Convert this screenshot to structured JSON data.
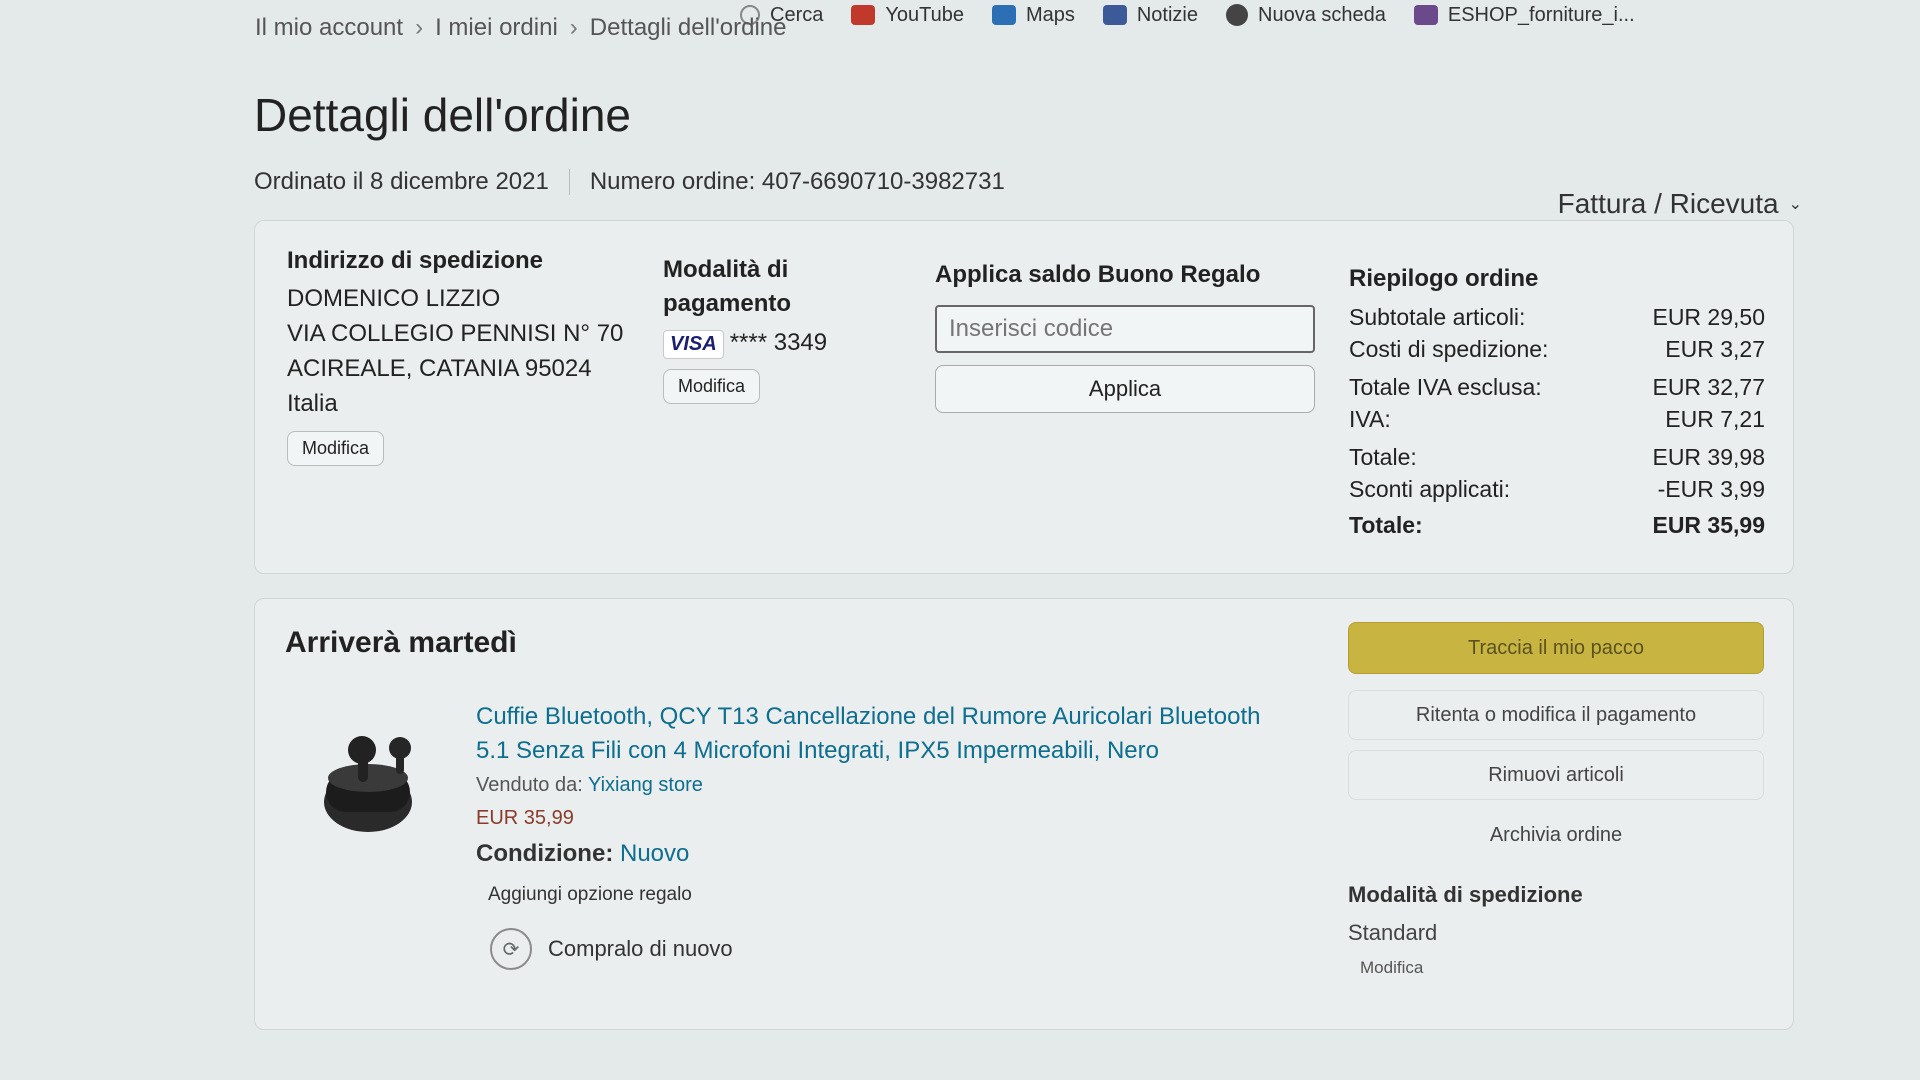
{
  "bookmarks": [
    {
      "label": "Cerca",
      "icon": "search-icon",
      "color": "#888888"
    },
    {
      "label": "YouTube",
      "icon": "youtube-icon",
      "color": "#c0392b"
    },
    {
      "label": "Maps",
      "icon": "maps-icon",
      "color": "#2c6fb5"
    },
    {
      "label": "Notizie",
      "icon": "news-icon",
      "color": "#3d5a98"
    },
    {
      "label": "Nuova scheda",
      "icon": "new-tab-icon",
      "color": "#444444"
    },
    {
      "label": "ESHOP_forniture_i...",
      "icon": "bag-icon",
      "color": "#6a4a8a"
    }
  ],
  "breadcrumb": {
    "items": [
      "Il mio account",
      "I miei ordini",
      "Dettagli dell'ordine"
    ],
    "separator": "›"
  },
  "page_title": "Dettagli dell'ordine",
  "order": {
    "date": "Ordinato il 8 dicembre 2021",
    "number": "Numero ordine: 407-6690710-3982731"
  },
  "invoice_label": "Fattura / Ricevuta",
  "shipping_address": {
    "title": "Indirizzo di spedizione",
    "name": "DOMENICO LIZZIO",
    "street": "VIA COLLEGIO PENNISI N° 70",
    "city": "ACIREALE, CATANIA 95024",
    "country": "Italia",
    "edit": "Modifica"
  },
  "payment": {
    "title": "Modalità di pagamento",
    "card_brand": "VISA",
    "card_digits": "**** 3349",
    "edit": "Modifica"
  },
  "gift_card": {
    "title": "Applica saldo Buono Regalo",
    "placeholder": "Inserisci codice",
    "apply": "Applica"
  },
  "summary": {
    "title": "Riepilogo ordine",
    "rows": [
      {
        "label": "Subtotale articoli:",
        "value": "EUR 29,50"
      },
      {
        "label": "Costi di spedizione:",
        "value": "EUR 3,27"
      },
      {
        "label": "Totale IVA esclusa:",
        "value": "EUR 32,77"
      },
      {
        "label": "IVA:",
        "value": "EUR 7,21"
      },
      {
        "label": "Totale:",
        "value": "EUR 39,98"
      },
      {
        "label": "Sconti applicati:",
        "value": "-EUR 3,99"
      },
      {
        "label": "Totale:",
        "value": "EUR 35,99"
      }
    ]
  },
  "delivery": {
    "title": "Arriverà martedì",
    "product": {
      "title": "Cuffie Bluetooth, QCY T13 Cancellazione del Rumore Auricolari Bluetooth 5.1 Senza Fili con 4 Microfoni Integrati, IPX5 Impermeabili, Nero",
      "sold_by_label": "Venduto da:",
      "seller": "Yixiang store",
      "price": "EUR 35,99",
      "condition_label": "Condizione:",
      "condition": "Nuovo",
      "gift_option": "Aggiungi opzione regalo",
      "buy_again": "Compralo di nuovo"
    }
  },
  "actions": {
    "track": "Traccia il mio pacco",
    "retry_payment": "Ritenta o modifica il pagamento",
    "remove_items": "Rimuovi articoli",
    "archive": "Archivia ordine"
  },
  "shipping_method": {
    "title": "Modalità di spedizione",
    "value": "Standard",
    "edit": "Modifica"
  },
  "colors": {
    "link": "#0e6e8f",
    "track_button": "#c8b441",
    "price": "#8a3b2a"
  }
}
